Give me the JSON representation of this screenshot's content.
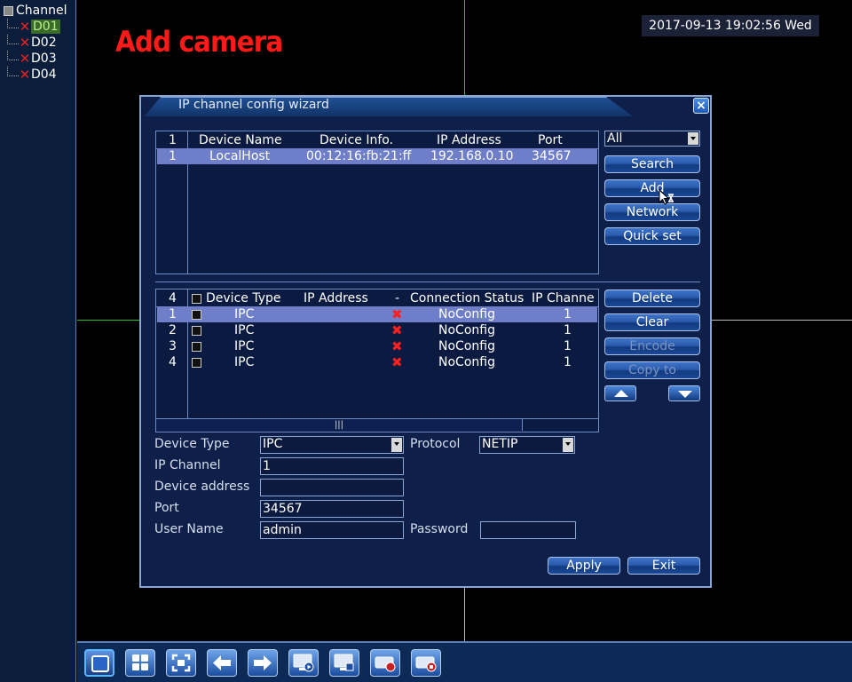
{
  "overlay_title": "Add camera",
  "datetime": "2017-09-13 19:02:56 Wed",
  "channel_tree": {
    "root_label": "Channel",
    "items": [
      {
        "label": "D01",
        "selected": true
      },
      {
        "label": "D02",
        "selected": false
      },
      {
        "label": "D03",
        "selected": false
      },
      {
        "label": "D04",
        "selected": false
      }
    ]
  },
  "dialog": {
    "title": "IP channel config wizard",
    "close_label": "×",
    "search_table": {
      "headers": [
        "1",
        "Device Name",
        "Device Info.",
        "IP Address",
        "Port"
      ],
      "rows": [
        [
          "1",
          "LocalHost",
          "00:12:16:fb:21:ff",
          "192.168.0.10",
          "34567"
        ]
      ]
    },
    "filter_select": "All",
    "buttons": {
      "search": "Search",
      "add": "Add",
      "network": "Network",
      "quick_set": "Quick set",
      "delete": "Delete",
      "clear": "Clear",
      "encode": "Encode",
      "copy_to": "Copy to",
      "apply": "Apply",
      "exit": "Exit"
    },
    "channel_table": {
      "headers": [
        "4",
        "Device Type",
        "IP Address",
        "-",
        "Connection Status",
        "IP Channe"
      ],
      "rows": [
        [
          "1",
          "IPC",
          "",
          "NoConfig",
          "1"
        ],
        [
          "2",
          "IPC",
          "",
          "NoConfig",
          "1"
        ],
        [
          "3",
          "IPC",
          "",
          "NoConfig",
          "1"
        ],
        [
          "4",
          "IPC",
          "",
          "NoConfig",
          "1"
        ]
      ],
      "scroll_thumb": "|||"
    },
    "form": {
      "device_type_label": "Device Type",
      "device_type_value": "IPC",
      "protocol_label": "Protocol",
      "protocol_value": "NETIP",
      "ip_channel_label": "IP Channel",
      "ip_channel_value": "1",
      "device_address_label": "Device address",
      "device_address_value": "",
      "port_label": "Port",
      "port_value": "34567",
      "user_name_label": "User Name",
      "user_name_value": "admin",
      "password_label": "Password",
      "password_value": ""
    }
  },
  "toolbar_icons": [
    "single-view-icon",
    "quad-view-icon",
    "fullscreen-icon",
    "previous-icon",
    "next-icon",
    "playback-icon",
    "screen-record-icon",
    "record-icon",
    "stop-record-icon"
  ]
}
